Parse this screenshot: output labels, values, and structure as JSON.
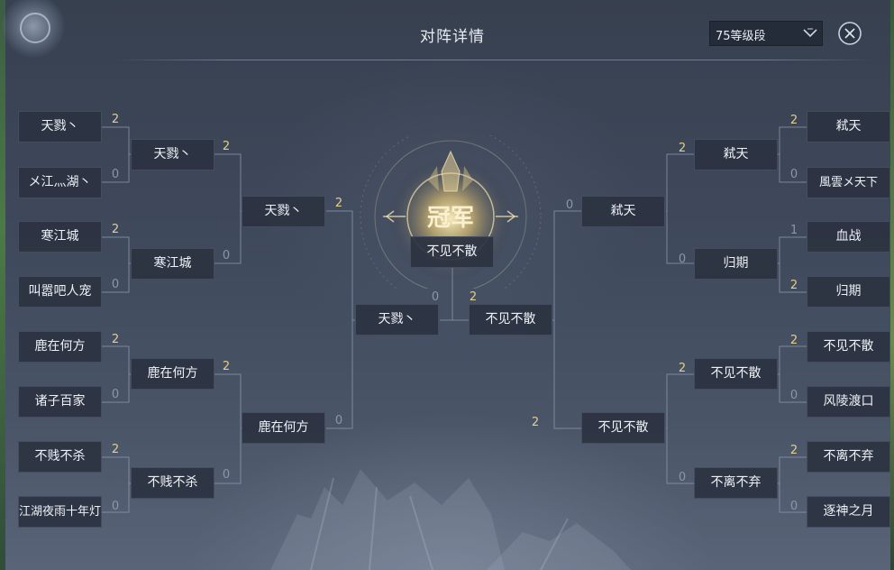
{
  "dialog": {
    "title": "对阵详情"
  },
  "level_select": {
    "selected": "75等级段"
  },
  "champion": {
    "badge_text": "冠军",
    "name": "不见不散"
  },
  "left_bracket": {
    "round1": [
      {
        "name": "天戮丶",
        "score": "2"
      },
      {
        "name": "メ江灬湖丶",
        "score": "0"
      },
      {
        "name": "寒江城",
        "score": "2"
      },
      {
        "name": "叫嚣吧人宠",
        "score": "0"
      },
      {
        "name": "鹿在何方",
        "score": "2"
      },
      {
        "name": "诸子百家",
        "score": "0"
      },
      {
        "name": "不贱不杀",
        "score": "2"
      },
      {
        "name": "江湖夜雨十年灯",
        "score": "0"
      }
    ],
    "round2": [
      {
        "name": "天戮丶",
        "score": "2"
      },
      {
        "name": "寒江城",
        "score": "0"
      },
      {
        "name": "鹿在何方",
        "score": "2"
      },
      {
        "name": "不贱不杀",
        "score": "0"
      }
    ],
    "round3": [
      {
        "name": "天戮丶",
        "score": "2"
      },
      {
        "name": "鹿在何方",
        "score": "0"
      }
    ],
    "final": {
      "name": "天戮丶",
      "score": "0"
    }
  },
  "right_bracket": {
    "round1": [
      {
        "name": "弒天",
        "score": "2"
      },
      {
        "name": "風雲メ天下",
        "score": "0"
      },
      {
        "name": "血战",
        "score": "1"
      },
      {
        "name": "归期",
        "score": "2"
      },
      {
        "name": "不见不散",
        "score": "2"
      },
      {
        "name": "风陵渡口",
        "score": "0"
      },
      {
        "name": "不离不弃",
        "score": "2"
      },
      {
        "name": "逐神之月",
        "score": "0"
      }
    ],
    "round2": [
      {
        "name": "弒天",
        "score": "2"
      },
      {
        "name": "归期",
        "score": "0"
      },
      {
        "name": "不见不散",
        "score": "2"
      },
      {
        "name": "不离不弃",
        "score": "0"
      }
    ],
    "round3": [
      {
        "name": "弒天",
        "score": "0"
      },
      {
        "name": "不见不散",
        "score": "2"
      }
    ],
    "final": {
      "name": "不见不散",
      "score": "2"
    }
  }
}
